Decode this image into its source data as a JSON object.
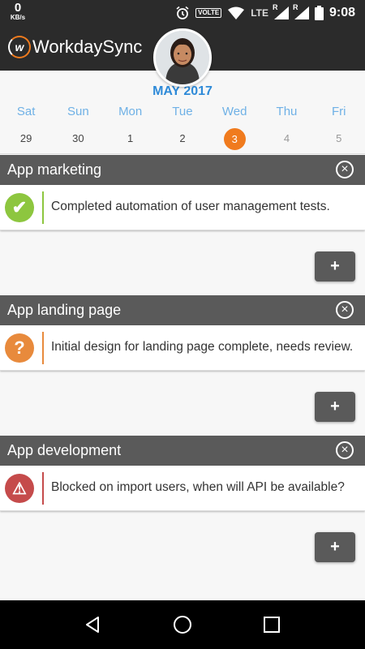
{
  "status_bar": {
    "speed_value": "0",
    "speed_unit": "KB/s",
    "volte_label": "VOLTE",
    "lte_label": "LTE",
    "roaming_label_1": "R",
    "roaming_label_2": "R",
    "time": "9:08",
    "icons": [
      "alarm-icon",
      "wifi-icon",
      "signal-icon",
      "signal-icon",
      "battery-icon"
    ]
  },
  "app_bar": {
    "logo_mark": "w",
    "app_name": "WorkdaySync"
  },
  "calendar": {
    "month": "MAY 2017",
    "weekdays": [
      "Sat",
      "Sun",
      "Mon",
      "Tue",
      "Wed",
      "Thu",
      "Fri"
    ],
    "dates": [
      "29",
      "30",
      "1",
      "2",
      "3",
      "4",
      "5"
    ],
    "selected_index": 4,
    "accent_color": "#f07b1e",
    "weekday_color": "#6fb1e6"
  },
  "projects": [
    {
      "title": "App marketing",
      "task": {
        "status": "done",
        "status_glyph": "✔",
        "text": "Completed automation of user management tests."
      },
      "add_label": "+"
    },
    {
      "title": "App landing page",
      "task": {
        "status": "review",
        "status_glyph": "?",
        "text": "Initial design for landing page complete, needs review."
      },
      "add_label": "+"
    },
    {
      "title": "App development",
      "task": {
        "status": "blocked",
        "status_glyph": "⚠",
        "text": "Blocked on import users, when will API be available?"
      },
      "add_label": "+"
    }
  ],
  "colors": {
    "done": "#8dc63f",
    "review": "#e88a3c",
    "blocked": "#c54b4b",
    "header_bg": "#5a5a5a",
    "appbar_bg": "#2b2b2b"
  },
  "nav_bar": {
    "icons": [
      "back-icon",
      "home-icon",
      "recents-icon"
    ]
  }
}
